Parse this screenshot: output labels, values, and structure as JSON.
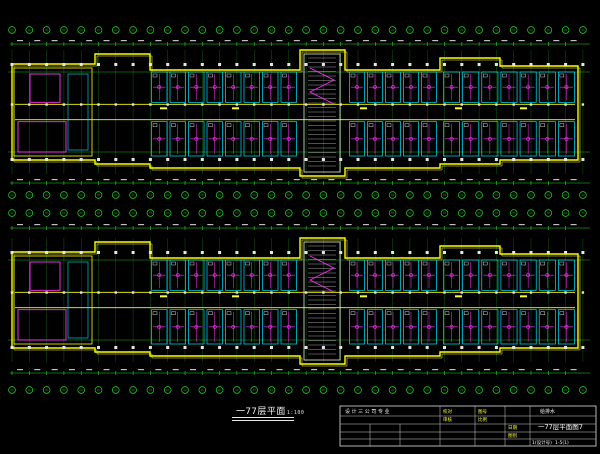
{
  "drawing": {
    "caption_main": "一77层平面",
    "caption_sub": "1:100",
    "caption_sub2": "1:100",
    "colors": {
      "background": "#000000",
      "axis": "#22dd22",
      "wall": "#ffff00",
      "column": "#e6e6e6",
      "room": "#00e5ff",
      "fixture": "#ff33ff",
      "label": "#ffffff",
      "tag": "#ffff33"
    }
  },
  "title_block": {
    "header_text": "设 计 三 公 司 专 业",
    "cells": [
      "校对",
      "审核",
      "图号",
      "比例",
      "日期",
      "图别"
    ],
    "project_value": "给排水",
    "drawing_name": "一77层平面图7",
    "sheet_no": "1-5(1)",
    "sheet_ref": "1(设计号)"
  }
}
